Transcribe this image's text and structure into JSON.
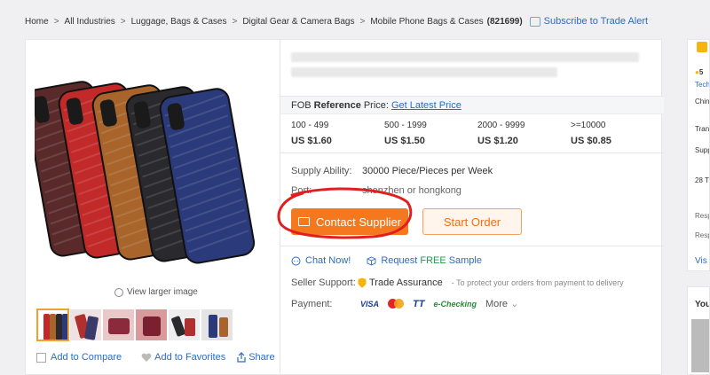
{
  "breadcrumb": {
    "items": [
      "Home",
      "All Industries",
      "Luggage, Bags & Cases",
      "Digital Gear & Camera Bags",
      "Mobile Phone Bags & Cases"
    ],
    "count": "(821699)",
    "subscribe": "Subscribe to Trade Alert"
  },
  "gallery": {
    "view_larger": "View larger image",
    "add_compare": "Add to Compare",
    "add_favorites": "Add to Favorites",
    "share": "Share",
    "case_colors": [
      "#5a2a2a",
      "#c22a2a",
      "#a8642a",
      "#2a2a2e",
      "#2a3a7a"
    ]
  },
  "price": {
    "fob_label": "FOB",
    "reference_label": "Reference",
    "price_label": "Price:",
    "latest_link": "Get Latest Price",
    "tiers": [
      {
        "qty": "100 - 499",
        "price": "US $1.60"
      },
      {
        "qty": "500 - 1999",
        "price": "US $1.50"
      },
      {
        "qty": "2000 - 9999",
        "price": "US $1.20"
      },
      {
        "qty": ">=10000",
        "price": "US $0.85"
      }
    ]
  },
  "supply": {
    "label": "Supply Ability:",
    "value": "30000 Piece/Pieces per Week"
  },
  "port": {
    "label": "Port:",
    "value": "shenzhen or hongkong"
  },
  "buttons": {
    "contact": "Contact Supplier",
    "start": "Start Order"
  },
  "chat": {
    "chat_now": "Chat Now!",
    "request": "Request",
    "free": "FREE",
    "sample": "Sample"
  },
  "seller": {
    "label": "Seller Support:",
    "value": "Trade Assurance",
    "note": "- To protect your orders from payment to delivery"
  },
  "payment": {
    "label": "Payment:",
    "methods": [
      "VISA",
      "TT",
      "e-Checking"
    ],
    "more": "More"
  },
  "right_col": {
    "items": [
      "5",
      "Tech",
      "Chin",
      "Tran",
      "Supp",
      "28 T",
      "Resp",
      "Resp",
      "Vis"
    ],
    "bottom": "You"
  },
  "colors": {
    "accent": "#f5781e",
    "link": "#2a6cc0",
    "annotation": "#e02020"
  }
}
